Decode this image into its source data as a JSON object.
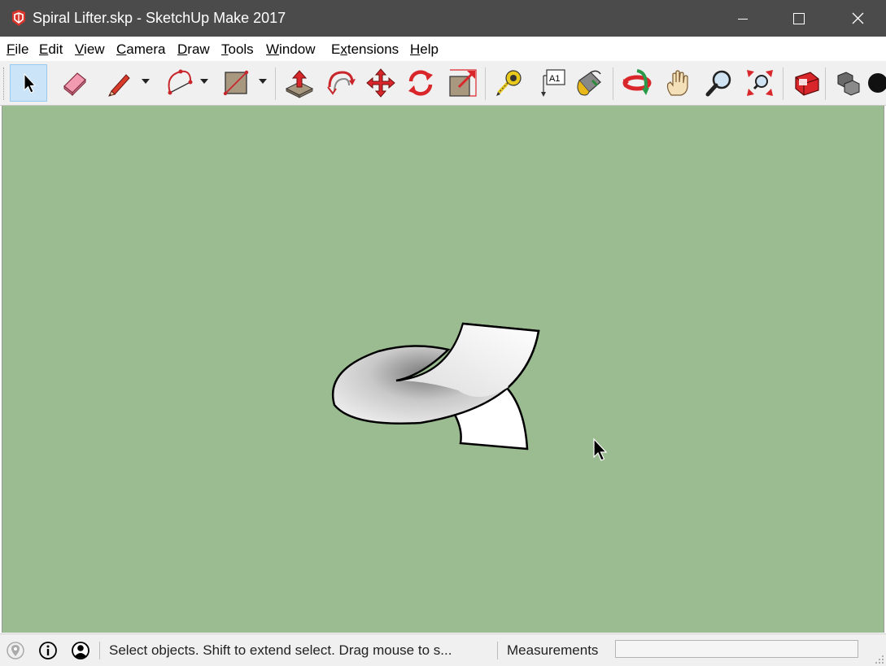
{
  "window": {
    "title": "Spiral Lifter.skp - SketchUp Make 2017",
    "controls": [
      "minimize-icon",
      "maximize-icon",
      "close-icon"
    ]
  },
  "menu": {
    "items": [
      {
        "label": "File",
        "accel": "F",
        "rest": "ile"
      },
      {
        "label": "Edit",
        "accel": "E",
        "rest": "dit"
      },
      {
        "label": "View",
        "accel": "V",
        "rest": "iew"
      },
      {
        "label": "Camera",
        "accel": "C",
        "rest": "amera"
      },
      {
        "label": "Draw",
        "accel": "D",
        "rest": "raw"
      },
      {
        "label": "Tools",
        "accel": "T",
        "rest": "ools"
      },
      {
        "label": "Window",
        "accel": "W",
        "rest": "indow"
      },
      {
        "label": "Extensions",
        "accel": "x",
        "rest_before": "E",
        "rest": "tensions"
      },
      {
        "label": "Help",
        "accel": "H",
        "rest": "elp"
      }
    ]
  },
  "toolbar": {
    "tools": [
      "select",
      "eraser",
      "pencil-line",
      "arc",
      "rectangle",
      "push-pull",
      "follow-me",
      "move",
      "rotate",
      "scale",
      "tape-measure",
      "text",
      "paint-bucket",
      "orbit",
      "pan",
      "zoom",
      "zoom-extents",
      "3d-warehouse",
      "components"
    ],
    "active_tool": "select",
    "text_tool_glyph": "A1"
  },
  "status": {
    "hint": "Select objects. Shift to extend select. Drag mouse to s...",
    "measurements_label": "Measurements",
    "measurements_value": ""
  },
  "colors": {
    "titlebar": "#4b4b4b",
    "viewport_background": "#9bbb90",
    "toolbar_background": "#f0f0f0",
    "active_tool_highlight": "#cce4f7"
  }
}
